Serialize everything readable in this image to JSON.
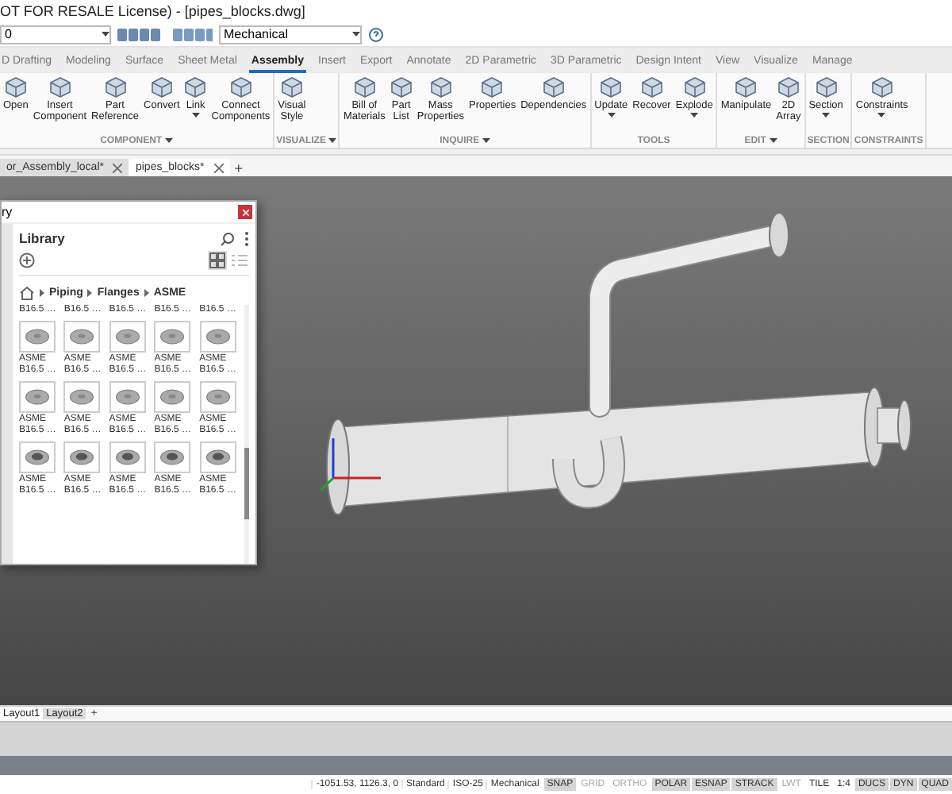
{
  "window": {
    "title": "OT FOR RESALE License) - [pipes_blocks.dwg]"
  },
  "quick_toolbar": {
    "layer": "0",
    "workspace": "Mechanical"
  },
  "ribbon_tabs": [
    {
      "label": "D Drafting",
      "selected": false
    },
    {
      "label": "Modeling",
      "selected": false
    },
    {
      "label": "Surface",
      "selected": false
    },
    {
      "label": "Sheet Metal",
      "selected": false
    },
    {
      "label": "Assembly",
      "selected": true
    },
    {
      "label": "Insert",
      "selected": false
    },
    {
      "label": "Export",
      "selected": false
    },
    {
      "label": "Annotate",
      "selected": false
    },
    {
      "label": "2D Parametric",
      "selected": false
    },
    {
      "label": "3D Parametric",
      "selected": false
    },
    {
      "label": "Design Intent",
      "selected": false
    },
    {
      "label": "View",
      "selected": false
    },
    {
      "label": "Visualize",
      "selected": false
    },
    {
      "label": "Manage",
      "selected": false
    }
  ],
  "ribbon_groups": [
    {
      "label": "COMPONENT",
      "expandable": true,
      "buttons": [
        {
          "label": "Open",
          "has_menu": false
        },
        {
          "label": "Insert\nComponent",
          "has_menu": false
        },
        {
          "label": "Part\nReference",
          "has_menu": false
        },
        {
          "label": "Convert",
          "has_menu": false
        },
        {
          "label": "Link",
          "has_menu": true
        },
        {
          "label": "Connect\nComponents",
          "has_menu": false
        }
      ]
    },
    {
      "label": "VISUALIZE",
      "expandable": true,
      "buttons": [
        {
          "label": "Visual\nStyle",
          "has_menu": false
        }
      ]
    },
    {
      "label": "INQUIRE",
      "expandable": true,
      "buttons": [
        {
          "label": "Bill of\nMaterials",
          "has_menu": false
        },
        {
          "label": "Part\nList",
          "has_menu": false
        },
        {
          "label": "Mass\nProperties",
          "has_menu": false
        },
        {
          "label": "Properties",
          "has_menu": false
        },
        {
          "label": "Dependencies",
          "has_menu": false
        }
      ]
    },
    {
      "label": "TOOLS",
      "expandable": false,
      "buttons": [
        {
          "label": "Update",
          "has_menu": true
        },
        {
          "label": "Recover",
          "has_menu": false
        },
        {
          "label": "Explode",
          "has_menu": true
        }
      ]
    },
    {
      "label": "EDIT",
      "expandable": true,
      "buttons": [
        {
          "label": "Manipulate",
          "has_menu": false
        },
        {
          "label": "2D\nArray",
          "has_menu": false
        }
      ]
    },
    {
      "label": "SECTION",
      "expandable": false,
      "buttons": [
        {
          "label": "Section",
          "has_menu": true
        }
      ]
    },
    {
      "label": "CONSTRAINTS",
      "expandable": false,
      "buttons": [
        {
          "label": "Constraints",
          "has_menu": true
        }
      ]
    }
  ],
  "document_tabs": [
    {
      "label": "or_Assembly_local*",
      "selected": false
    },
    {
      "label": "pipes_blocks*",
      "selected": true
    }
  ],
  "new_tab": "+",
  "library_panel": {
    "window_title": "ry",
    "title": "Library",
    "view_buttons": [
      {
        "kind": "grid",
        "selected": true
      },
      {
        "kind": "list",
        "selected": false
      }
    ],
    "breadcrumb": [
      "Piping",
      "Flanges",
      "ASME"
    ],
    "items": [
      {
        "label": "B16.5 …",
        "thumbnail": false
      },
      {
        "label": "B16.5 …",
        "thumbnail": false
      },
      {
        "label": "B16.5 …",
        "thumbnail": false
      },
      {
        "label": "B16.5 …",
        "thumbnail": false
      },
      {
        "label": "B16.5 …",
        "thumbnail": false
      },
      {
        "label": "ASME\nB16.5 …",
        "thumbnail": true
      },
      {
        "label": "ASME\nB16.5 …",
        "thumbnail": true
      },
      {
        "label": "ASME\nB16.5 …",
        "thumbnail": true
      },
      {
        "label": "ASME\nB16.5 …",
        "thumbnail": true
      },
      {
        "label": "ASME\nB16.5 …",
        "thumbnail": true
      },
      {
        "label": "ASME\nB16.5 …",
        "thumbnail": true
      },
      {
        "label": "ASME\nB16.5 …",
        "thumbnail": true
      },
      {
        "label": "ASME\nB16.5 …",
        "thumbnail": true
      },
      {
        "label": "ASME\nB16.5 …",
        "thumbnail": true
      },
      {
        "label": "ASME\nB16.5 …",
        "thumbnail": true
      },
      {
        "label": "ASME\nB16.5 …",
        "thumbnail": true
      },
      {
        "label": "ASME\nB16.5 …",
        "thumbnail": true
      },
      {
        "label": "ASME\nB16.5 …",
        "thumbnail": true
      },
      {
        "label": "ASME\nB16.5 …",
        "thumbnail": true
      },
      {
        "label": "ASME\nB16.5 …",
        "thumbnail": true
      }
    ]
  },
  "layout_tabs": [
    {
      "label": "Layout1",
      "selected": true
    },
    {
      "label": "Layout2",
      "selected": false
    }
  ],
  "new_layout": "+",
  "status_bar": {
    "coordinates": "-1051.53, 1126.3, 0",
    "fields": [
      "Standard",
      "ISO-25",
      "Mechanical"
    ],
    "toggles": [
      {
        "label": "SNAP",
        "on": true
      },
      {
        "label": "GRID",
        "on": false
      },
      {
        "label": "ORTHO",
        "on": false
      },
      {
        "label": "POLAR",
        "on": true
      },
      {
        "label": "ESNAP",
        "on": true
      },
      {
        "label": "STRACK",
        "on": true
      },
      {
        "label": "LWT",
        "on": false
      },
      {
        "label": "TILE"
      },
      {
        "label": "1:4"
      },
      {
        "label": "DUCS",
        "on": true
      },
      {
        "label": "DYN",
        "on": true
      },
      {
        "label": "QUAD",
        "on": true
      }
    ]
  }
}
